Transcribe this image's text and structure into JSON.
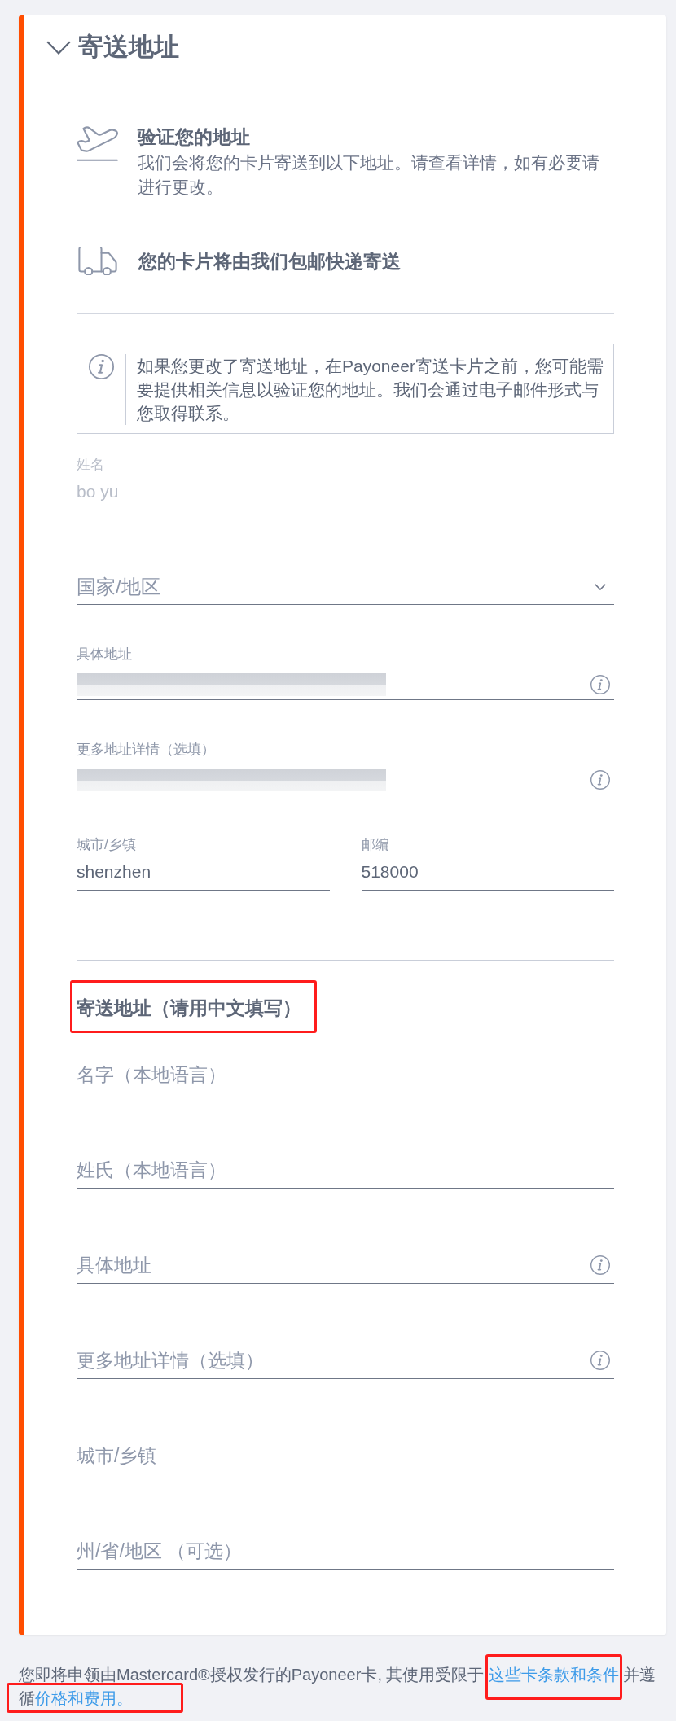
{
  "section": {
    "title": "寄送地址",
    "expanded": true
  },
  "notices": [
    {
      "kind": "plane",
      "title": "验证您的地址",
      "text": "我们会将您的卡片寄送到以下地址。请查看详情，如有必要请进行更改。"
    },
    {
      "kind": "truck",
      "title": "您的卡片将由我们包邮快递寄送"
    }
  ],
  "info_box": {
    "text": "如果您更改了寄送地址，在Payoneer寄送卡片之前，您可能需要提供相关信息以验证您的地址。我们会通过电子邮件形式与您取得联系。"
  },
  "address_fields": [
    {
      "kind": "text",
      "label": "姓名",
      "value": "bo yu",
      "disabled": true,
      "info_button": false
    },
    {
      "kind": "select",
      "placeholder": "国家/地区",
      "info_button": false
    },
    {
      "kind": "redacted",
      "label": "具体地址",
      "info_button": true
    },
    {
      "kind": "redacted",
      "label": "更多地址详情（选填）",
      "info_button": true
    },
    {
      "kind": "pair",
      "fields": [
        {
          "label": "城市/乡镇",
          "value": "shenzhen",
          "disabled": false,
          "info_button": false
        },
        {
          "label": "邮编",
          "value": "518000",
          "disabled": false,
          "info_button": false
        }
      ]
    }
  ],
  "local_address": {
    "heading": {
      "text": "寄送地址（请用中文填写）",
      "highlighted": true
    },
    "fields": [
      {
        "placeholder": "名字（本地语言）",
        "info_button": false
      },
      {
        "placeholder": "姓氏（本地语言）",
        "info_button": false
      },
      {
        "placeholder": "具体地址",
        "info_button": true
      },
      {
        "placeholder": "更多地址详情（选填）",
        "info_button": true
      },
      {
        "placeholder": "城市/乡镇",
        "info_button": false
      },
      {
        "placeholder": "州/省/地区 （可选）",
        "info_button": false
      }
    ]
  },
  "footer": {
    "parts": [
      {
        "kind": "text",
        "text": "您即将申领由Mastercard®授权发行的Payoneer卡, 其使用受限于"
      },
      {
        "kind": "link",
        "text": "这些卡条款和条件",
        "highlighted": true
      },
      {
        "kind": "text",
        "text": "并遵循"
      },
      {
        "kind": "link",
        "text": "价格和费用。",
        "highlighted": true
      }
    ]
  }
}
